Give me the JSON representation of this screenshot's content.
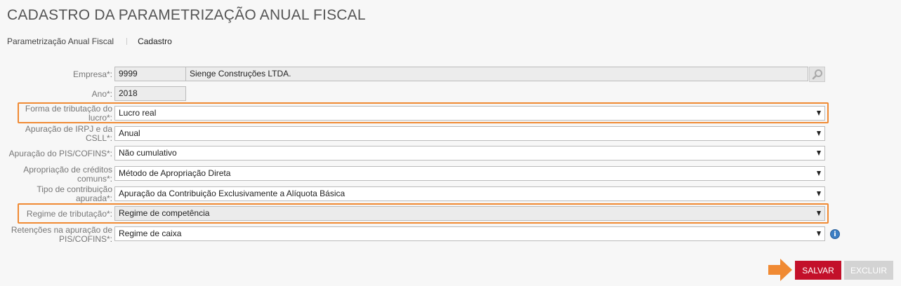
{
  "page": {
    "title": "CADASTRO DA PARAMETRIZAÇÃO ANUAL FISCAL",
    "breadcrumb": {
      "parent": "Parametrização Anual Fiscal",
      "current": "Cadastro"
    }
  },
  "form": {
    "empresa": {
      "label": "Empresa*:",
      "code": "9999",
      "name": "Sienge Construções LTDA."
    },
    "ano": {
      "label": "Ano*:",
      "value": "2018"
    },
    "forma_tributacao": {
      "label_line1": "Forma de tributação do",
      "label_line2": "lucro*:",
      "value": "Lucro real"
    },
    "apuracao_irpj": {
      "label_line1": "Apuração de IRPJ e da",
      "label_line2": "CSLL*:",
      "value": "Anual"
    },
    "apuracao_pis": {
      "label": "Apuração do PIS/COFINS*:",
      "value": "Não cumulativo"
    },
    "apropriacao_creditos": {
      "label_line1": "Apropriação de créditos",
      "label_line2": "comuns*:",
      "value": "Método de Apropriação Direta"
    },
    "tipo_contribuicao": {
      "label_line1": "Tipo de contribuição",
      "label_line2": "apurada*:",
      "value": "Apuração da Contribuição Exclusivamente a Alíquota Básica"
    },
    "regime_tributacao": {
      "label": "Regime de tributação*:",
      "value": "Regime de competência"
    },
    "retencoes": {
      "label_line1": "Retenções na apuração de",
      "label_line2": "PIS/COFINS*:",
      "value": "Regime de caixa"
    }
  },
  "buttons": {
    "save": "SALVAR",
    "delete": "EXCLUIR"
  },
  "icons": {
    "search": "search-icon",
    "info": "info-icon",
    "pointer": "arrow-right-icon"
  },
  "colors": {
    "highlight": "#f08a33",
    "save": "#c3102a",
    "delete_disabled": "#d3d3d3",
    "info": "#3d7fc4"
  }
}
